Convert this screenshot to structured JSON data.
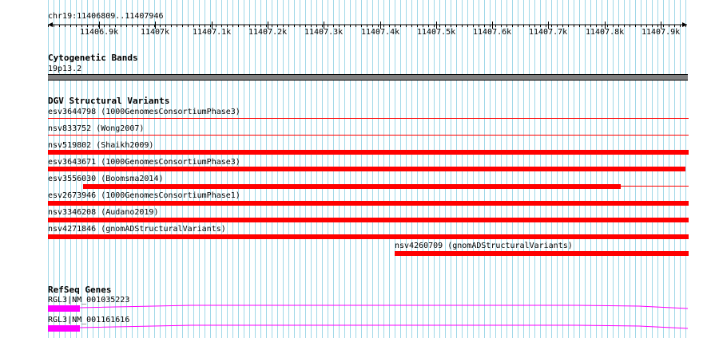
{
  "ruler": {
    "region": "chr19:11406809..11407946",
    "ticks": [
      "11406.9k",
      "11407k",
      "11407.1k",
      "11407.2k",
      "11407.3k",
      "11407.4k",
      "11407.5k",
      "11407.6k",
      "11407.7k",
      "11407.8k",
      "11407.9k"
    ]
  },
  "tracks": {
    "cytobands": {
      "title": "Cytogenetic Bands",
      "band": "19p13.2"
    },
    "dgv": {
      "title": "DGV Structural Variants",
      "variants": [
        {
          "label": "esv3644798 (1000GenomesConsortiumPhase3)"
        },
        {
          "label": "nsv833752 (Wong2007)"
        },
        {
          "label": "nsv519802 (Shaikh2009)"
        },
        {
          "label": "esv3643671 (1000GenomesConsortiumPhase3)"
        },
        {
          "label": "esv3556030 (Boomsma2014)"
        },
        {
          "label": "esv2673946 (1000GenomesConsortiumPhase1)"
        },
        {
          "label": "nsv3346208 (Audano2019)"
        },
        {
          "label": "nsv4271846 (gnomADStructuralVariants)"
        },
        {
          "label": "nsv4260709 (gnomADStructuralVariants)"
        }
      ]
    },
    "refseq": {
      "title": "RefSeq Genes",
      "genes": [
        {
          "label": "RGL3|NM_001035223"
        },
        {
          "label": "RGL3|NM_001161616"
        }
      ]
    }
  },
  "colors": {
    "variant": "#ff0000",
    "gene": "#ff00ff",
    "band": "#808080",
    "grid": "#a0d8e8"
  }
}
